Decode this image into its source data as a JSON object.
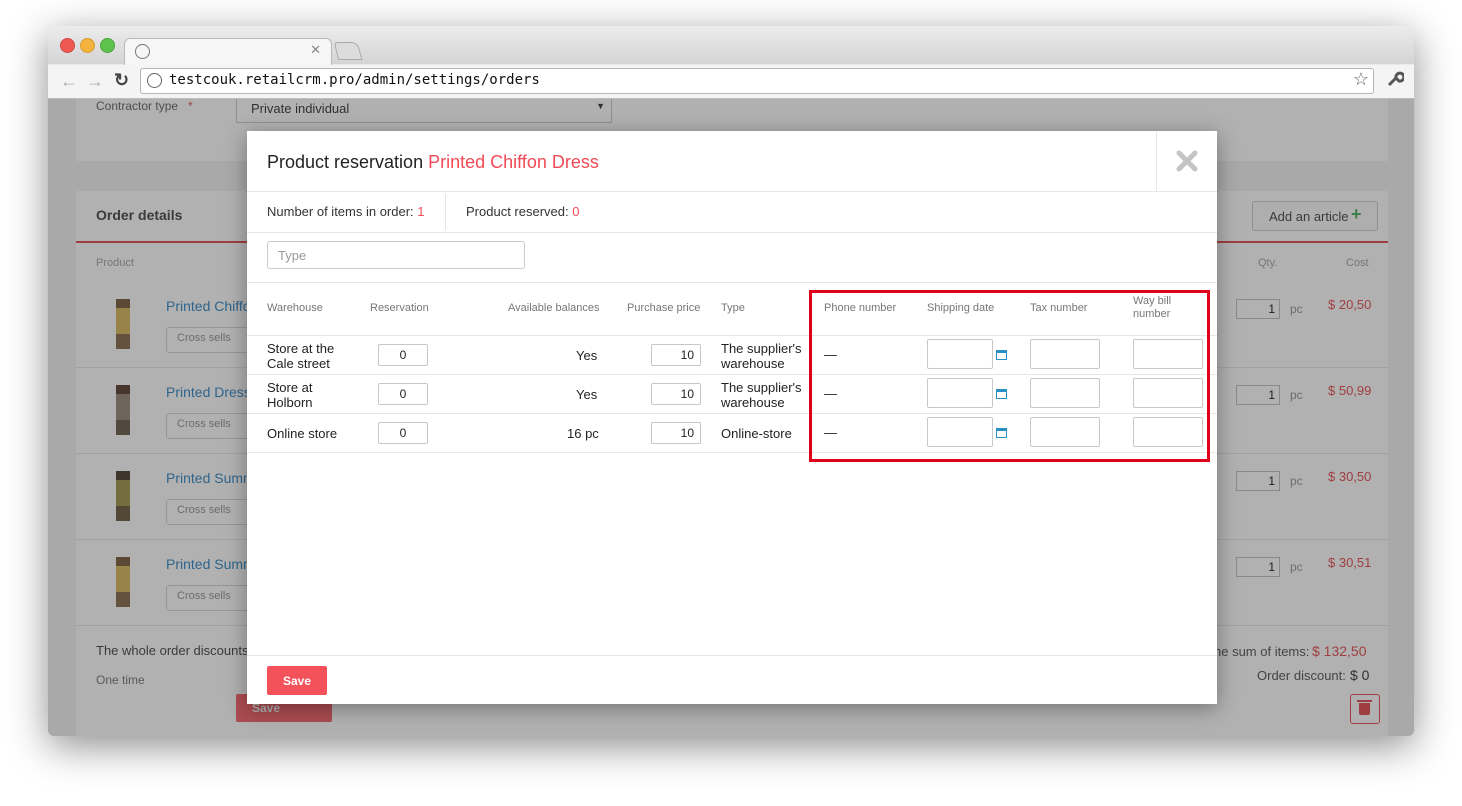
{
  "browser": {
    "tab_title": "",
    "url": "testcouk.retailcrm.pro/admin/settings/orders"
  },
  "background": {
    "contractor_label": "Contractor type",
    "required_mark": "*",
    "contractor_value": "Private individual",
    "order_details_title": "Order details",
    "add_article_label": "Add an article",
    "col_product": "Product",
    "col_qty": "Qty.",
    "col_cost": "Cost",
    "cross_sells_label": "Cross sells",
    "items": [
      {
        "name": "Printed Chiffon Dress",
        "qty": "1",
        "unit": "pc",
        "cost": "$ 20,50"
      },
      {
        "name": "Printed Dress",
        "qty": "1",
        "unit": "pc",
        "cost": "$ 50,99"
      },
      {
        "name": "Printed Summer Dress",
        "qty": "1",
        "unit": "pc",
        "cost": "$ 30,50"
      },
      {
        "name": "Printed Summer Dress",
        "qty": "1",
        "unit": "pc",
        "cost": "$ 30,51"
      }
    ],
    "whole_discount_label": "The whole order discounts",
    "one_time_label": "One time",
    "sum_of_items_label": "he sum of items:",
    "sum_of_items_value": "$ 132,50",
    "order_discount_label": "Order discount:",
    "order_discount_value": "$ 0",
    "save_label": "Save"
  },
  "modal": {
    "title": "Product reservation",
    "product_name": "Printed Chiffon Dress",
    "items_in_order_label": "Number of items in order:",
    "items_in_order_value": "1",
    "reserved_label": "Product reserved:",
    "reserved_value": "0",
    "search_placeholder": "Type",
    "columns": {
      "warehouse": "Warehouse",
      "reservation": "Reservation",
      "available": "Available balances",
      "purchase_price": "Purchase price",
      "type": "Type",
      "phone": "Phone number",
      "shipping_date": "Shipping date",
      "tax_number": "Tax number",
      "waybill_line1": "Way bill",
      "waybill_line2": "number"
    },
    "rows": [
      {
        "warehouse_line1": "Store at the",
        "warehouse_line2": "Cale street",
        "reservation": "0",
        "available": "Yes",
        "price": "10",
        "type_line1": "The supplier's",
        "type_line2": "warehouse",
        "phone": "—"
      },
      {
        "warehouse_line1": "Store at",
        "warehouse_line2": "Holborn",
        "reservation": "0",
        "available": "Yes",
        "price": "10",
        "type_line1": "The supplier's",
        "type_line2": "warehouse",
        "phone": "—"
      },
      {
        "warehouse_line1": "Online store",
        "warehouse_line2": "",
        "reservation": "0",
        "available": "16 pc",
        "price": "10",
        "type_line1": "Online-store",
        "type_line2": "",
        "phone": "—"
      }
    ],
    "save_label": "Save"
  },
  "colors": {
    "accent": "#f24a56",
    "highlight": "#e0001b",
    "link": "#1f7bbf",
    "calendar": "#2a8fc4"
  },
  "icons": [
    "globe-icon",
    "close-icon",
    "back-icon",
    "forward-icon",
    "reload-icon",
    "star-icon",
    "wrench-icon",
    "calendar-icon",
    "plus-icon",
    "trash-icon",
    "menu-icon"
  ]
}
